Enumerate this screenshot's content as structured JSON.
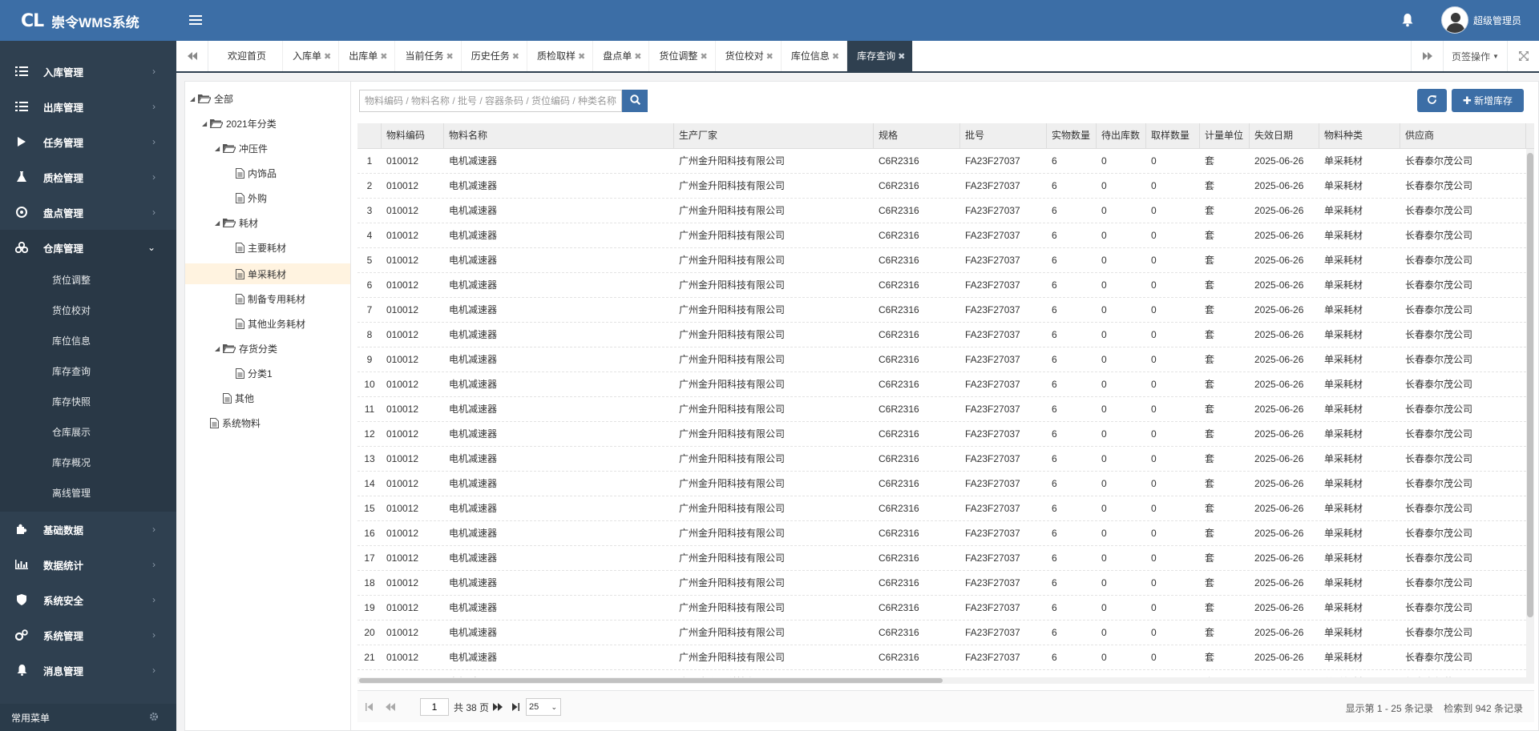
{
  "app": {
    "logo_mark": "CL",
    "title": "崇令WMS系统"
  },
  "header": {
    "user_name": "超级管理员"
  },
  "sidebar": {
    "items": [
      {
        "label": "入库管理",
        "icon": "list-indent-icon"
      },
      {
        "label": "出库管理",
        "icon": "list-icon"
      },
      {
        "label": "任务管理",
        "icon": "play-icon"
      },
      {
        "label": "质检管理",
        "icon": "flask-icon"
      },
      {
        "label": "盘点管理",
        "icon": "cubes-icon"
      },
      {
        "label": "仓库管理",
        "icon": "warehouse-icon",
        "open": true
      },
      {
        "label": "基础数据",
        "icon": "puzzle-icon"
      },
      {
        "label": "数据统计",
        "icon": "bar-chart-icon"
      },
      {
        "label": "系统安全",
        "icon": "shield-icon"
      },
      {
        "label": "系统管理",
        "icon": "gears-icon"
      },
      {
        "label": "消息管理",
        "icon": "bell-icon"
      }
    ],
    "warehouse_sub": [
      "货位调整",
      "货位校对",
      "库位信息",
      "库存查询",
      "库存快照",
      "仓库展示",
      "库存概况",
      "离线管理"
    ],
    "footer_label": "常用菜单"
  },
  "tabs": {
    "items": [
      {
        "label": "欢迎首页",
        "closable": false
      },
      {
        "label": "入库单",
        "closable": true
      },
      {
        "label": "出库单",
        "closable": true
      },
      {
        "label": "当前任务",
        "closable": true
      },
      {
        "label": "历史任务",
        "closable": true
      },
      {
        "label": "质检取样",
        "closable": true
      },
      {
        "label": "盘点单",
        "closable": true
      },
      {
        "label": "货位调整",
        "closable": true
      },
      {
        "label": "货位校对",
        "closable": true
      },
      {
        "label": "库位信息",
        "closable": true
      },
      {
        "label": "库存查询",
        "closable": true,
        "active": true
      }
    ],
    "page_ops": "页签操作",
    "close_glyph": "✖"
  },
  "tree": {
    "root": "全部",
    "n2021": "2021年分类",
    "chongya": "冲压件",
    "neishi": "内饰品",
    "waigou": "外购",
    "haocai": "耗材",
    "zhuyao": "主要耗材",
    "dancai": "单采耗材",
    "zhibei": "制备专用耗材",
    "qita_yewu": "其他业务耗材",
    "cunhuo": "存货分类",
    "fenlei1": "分类1",
    "qita": "其他",
    "xitong": "系统物料"
  },
  "toolbar": {
    "search_placeholder": "物料编码 / 物料名称 / 批号 / 容器条码 / 货位编码 / 种类名称",
    "add_label": "新增库存"
  },
  "grid": {
    "columns": [
      "",
      "物料编码",
      "物料名称",
      "生产厂家",
      "规格",
      "批号",
      "实物数量",
      "待出库数",
      "取样数量",
      "计量单位",
      "失效日期",
      "物料种类",
      "供应商"
    ],
    "row_template": [
      "010012",
      "电机减速器",
      "广州金升阳科技有限公司",
      "C6R2316",
      "FA23F27037",
      "6",
      "0",
      "0",
      "套",
      "2025-06-26",
      "单采耗材",
      "长春泰尔茂公司"
    ],
    "visible_rows": 22
  },
  "pager": {
    "current_page": "1",
    "total_pages_label": "共 38 页",
    "page_size": "25",
    "range_label": "显示第 1 - 25 条记录",
    "total_label": "检索到 942 条记录"
  },
  "colors": {
    "header": "#3c6ea6",
    "sidebar": "#2f4050",
    "accent": "#3c6ea6",
    "selected_node": "#fff3e0"
  }
}
